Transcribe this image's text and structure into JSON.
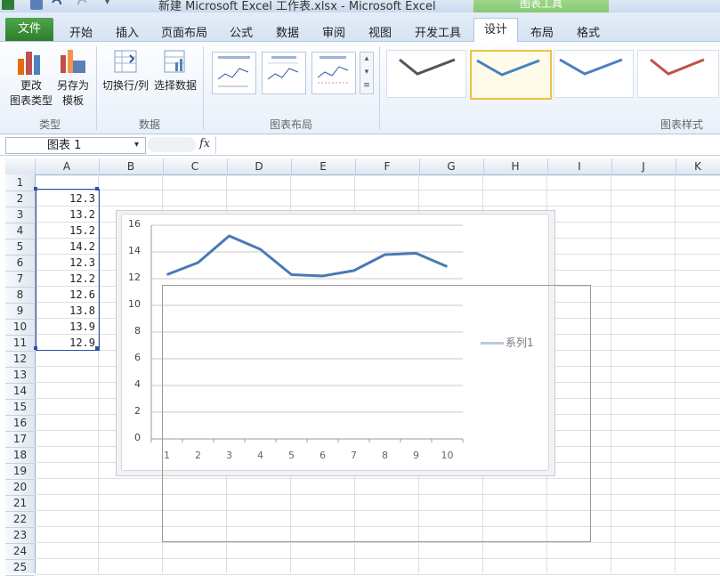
{
  "window": {
    "title": "新建 Microsoft Excel 工作表.xlsx  -  Microsoft Excel"
  },
  "chart_tools": {
    "header": "图表工具"
  },
  "tabs": {
    "file": "文件",
    "items": [
      "开始",
      "插入",
      "页面布局",
      "公式",
      "数据",
      "审阅",
      "视图",
      "开发工具"
    ],
    "design": "设计",
    "layout": "布局",
    "format": "格式"
  },
  "ribbon": {
    "type_group": {
      "label": "类型",
      "change_chart_type": [
        "更改",
        "图表类型"
      ],
      "save_as_template": [
        "另存为",
        "模板"
      ]
    },
    "data_group": {
      "label": "数据",
      "switch_row_col": "切换行/列",
      "select_data": "选择数据"
    },
    "layout_group": {
      "label": "图表布局"
    },
    "styles_group": {
      "label": "图表样式",
      "colors": [
        "#555555",
        "#4a7fc1",
        "#4a7fc1",
        "#c0504d"
      ]
    }
  },
  "formula_bar": {
    "name_box": "图表  1",
    "fx_label": "fx",
    "value": ""
  },
  "sheet": {
    "columns": [
      "A",
      "B",
      "C",
      "D",
      "E",
      "F",
      "G",
      "H",
      "I",
      "J",
      "K"
    ],
    "rows": [
      "1",
      "2",
      "3",
      "4",
      "5",
      "6",
      "7",
      "8",
      "9",
      "10",
      "11",
      "12",
      "13",
      "14",
      "15",
      "16",
      "17",
      "18",
      "19",
      "20",
      "21",
      "22",
      "23",
      "24",
      "25"
    ],
    "col_a_values": [
      "",
      "12.3",
      "13.2",
      "15.2",
      "14.2",
      "12.3",
      "12.2",
      "12.6",
      "13.8",
      "13.9",
      "12.9"
    ]
  },
  "chart_data": {
    "type": "line",
    "x": [
      1,
      2,
      3,
      4,
      5,
      6,
      7,
      8,
      9,
      10
    ],
    "series": [
      {
        "name": "系列1",
        "values": [
          12.3,
          13.2,
          15.2,
          14.2,
          12.3,
          12.2,
          12.6,
          13.8,
          13.9,
          12.9
        ],
        "color": "#4a7ab5"
      }
    ],
    "yticks": [
      "0",
      "2",
      "4",
      "6",
      "8",
      "10",
      "12",
      "14",
      "16"
    ],
    "xticks": [
      "1",
      "2",
      "3",
      "4",
      "5",
      "6",
      "7",
      "8",
      "9",
      "10"
    ],
    "ylim": [
      0,
      16
    ],
    "grid": true,
    "legend": "right"
  }
}
